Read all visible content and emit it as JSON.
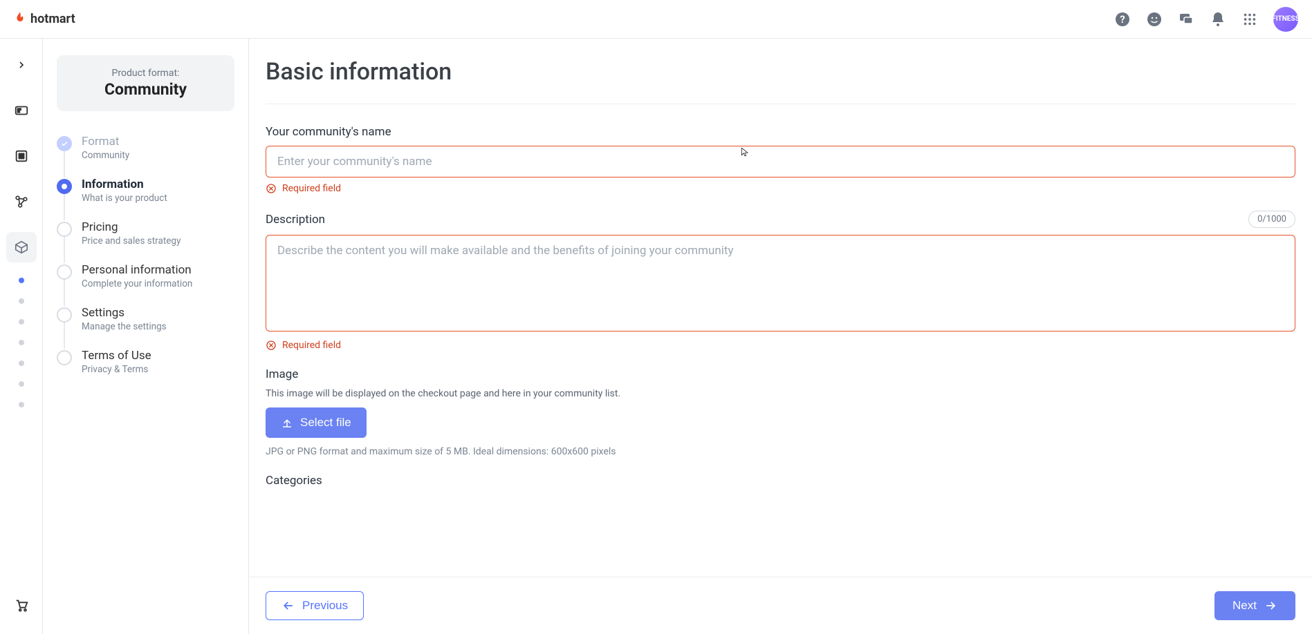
{
  "header": {
    "brand": "hotmart",
    "avatar_text": "FITNESS"
  },
  "product_format": {
    "label": "Product format:",
    "value": "Community"
  },
  "steps": [
    {
      "title": "Format",
      "sub": "Community",
      "state": "completed"
    },
    {
      "title": "Information",
      "sub": "What is your product",
      "state": "active"
    },
    {
      "title": "Pricing",
      "sub": "Price and sales strategy",
      "state": "pending"
    },
    {
      "title": "Personal information",
      "sub": "Complete your information",
      "state": "pending"
    },
    {
      "title": "Settings",
      "sub": "Manage the settings",
      "state": "pending"
    },
    {
      "title": "Terms of Use",
      "sub": "Privacy & Terms",
      "state": "pending"
    }
  ],
  "main": {
    "title": "Basic information",
    "name_field": {
      "label": "Your community's name",
      "placeholder": "Enter your community's name",
      "error": "Required field"
    },
    "description_field": {
      "label": "Description",
      "counter": "0/1000",
      "placeholder": "Describe the content you will make available and the benefits of joining your community",
      "error": "Required field"
    },
    "image_field": {
      "label": "Image",
      "help": "This image will be displayed on the checkout page and here in your community list.",
      "button": "Select file",
      "hint": "JPG or PNG format and maximum size of 5 MB. Ideal dimensions: 600x600 pixels"
    },
    "categories_field": {
      "label": "Categories"
    }
  },
  "footer": {
    "prev": "Previous",
    "next": "Next"
  }
}
